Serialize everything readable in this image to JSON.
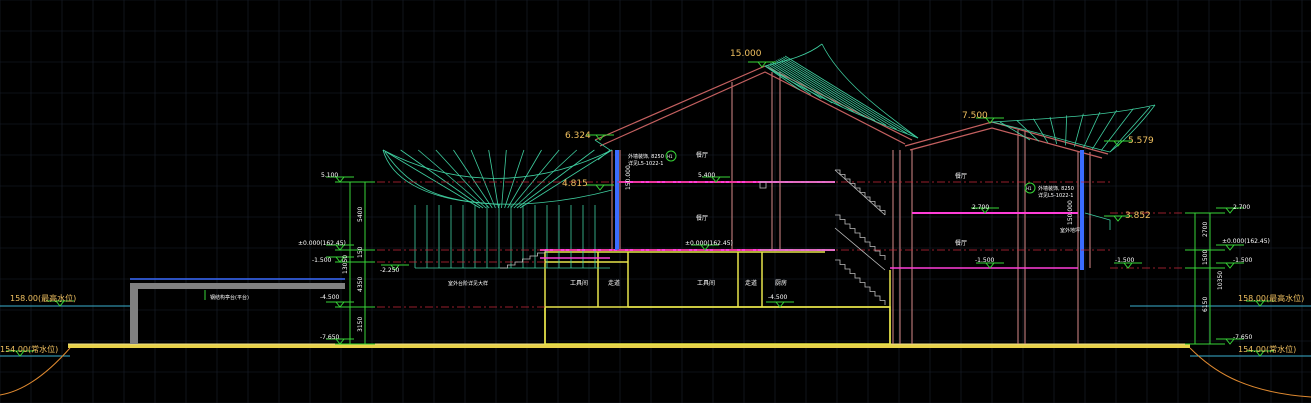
{
  "colors": {
    "background": "#000000",
    "grid": "#1d2330",
    "grid_major": "#262d3d",
    "ground": "#f0e38a",
    "ground_fill": "#e8d24a",
    "structure": "#e8e44a",
    "wall": "#d88a8a",
    "roof": "#c46060",
    "roof_mesh": "#3fcfa0",
    "floor": "#ff3dd8",
    "axis": "#c8283a",
    "cyan_water": "#3ab0d0",
    "dim_green": "#37d437",
    "text_white": "#ffffff",
    "text_yellow": "#f0c060",
    "terrain": "#e08a30",
    "stair": "#bfbfbf",
    "blue_wall": "#3a6cff",
    "gray_wall": "#808080"
  },
  "elevations": {
    "roof_top": "15.000",
    "roof_right": "7.500",
    "eave_left": "6.324",
    "eave_right": "5.579",
    "inner_eave": "4.815",
    "right_beam": "3.852"
  },
  "left_levels": {
    "l1": "5.100",
    "l2": "±0.000(162.45)",
    "l3": "-1.500",
    "l4": "-2.250",
    "l5": "-4.500",
    "l6": "-7.650"
  },
  "left_dims": {
    "d1": "5400",
    "d2": "150",
    "d3": "13050",
    "d4": "4350",
    "d5": "3150"
  },
  "right_levels": {
    "r1": "2.700",
    "r2": "±0.000(162.45)",
    "r3": "-1.500",
    "r4": "-7.650"
  },
  "right_dims": {
    "d1": "2700",
    "d2": "1500",
    "d3": "10350",
    "d4": "6150"
  },
  "water": {
    "high_left": "158.00(最高水位)",
    "high_right": "158.00(最高水位)",
    "low_left": "154.00(常水位)",
    "low_right": "154.00(常水位)"
  },
  "interior": {
    "floor_level_mid": "5.400",
    "floor_level_right": "2.700",
    "zero_mid": "±0.000(162.45)",
    "minus_mid": "-4.500",
    "minus_right": "-1.500",
    "minus_left": "-1.500",
    "room_upper_left": "餐厅",
    "room_mid_left": "餐厅",
    "room_upper_right": "餐厅",
    "room_mid_right": "餐厅",
    "room_b1": "工具间",
    "room_b2": "走道",
    "room_b3": "工具间",
    "room_b4": "走道",
    "room_b5": "厨房",
    "vert_label": "150.000",
    "vert_label_right": "150.000",
    "note_1": "外墙装饰, 8250",
    "note_2": "详见L5-1022-1",
    "note_3": "外墙装饰, 8250",
    "note_4": "详见L5-1022-1",
    "note_5": "室外地坪",
    "bubble_1": "H1",
    "bubble_2": "H1",
    "left_note": "钢结构亭台(平台)",
    "stair_note": "室外台阶详见大样"
  }
}
